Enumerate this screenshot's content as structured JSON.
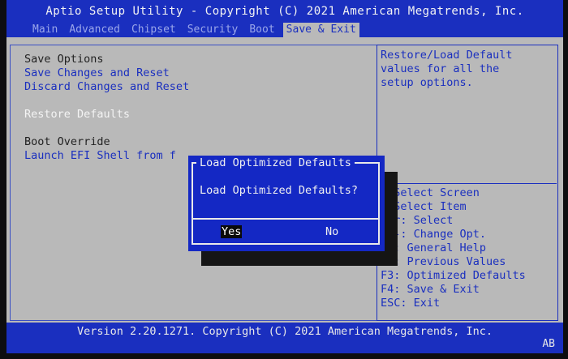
{
  "header": {
    "title": "Aptio Setup Utility - Copyright (C) 2021 American Megatrends, Inc.",
    "tabs": [
      {
        "label": "Main"
      },
      {
        "label": "Advanced"
      },
      {
        "label": "Chipset"
      },
      {
        "label": "Security"
      },
      {
        "label": "Boot"
      },
      {
        "label": "Save & Exit",
        "active": true
      }
    ]
  },
  "menu": {
    "save_options": "Save Options",
    "save_changes_reset": "Save Changes and Reset",
    "discard_changes_reset": "Discard Changes and Reset",
    "restore_defaults": "Restore Defaults",
    "boot_override": "Boot Override",
    "launch_efi_shell": "Launch EFI Shell from f"
  },
  "help": {
    "description": "Restore/Load Default\nvalues for all the\nsetup options.",
    "keys": [
      ": Select Screen",
      ": Select Item",
      "ter: Select",
      "+/-: Change Opt.",
      "F1: General Help",
      "F2: Previous Values",
      "F3: Optimized Defaults",
      "F4: Save & Exit",
      "ESC: Exit"
    ]
  },
  "dialog": {
    "title": "Load Optimized Defaults",
    "message": "Load Optimized Defaults?",
    "yes_label": "Yes",
    "no_label": "No"
  },
  "footer": {
    "version": "Version 2.20.1271. Copyright (C) 2021 American Megatrends, Inc.",
    "indicator": "AB"
  },
  "colors": {
    "bios_blue": "#1a2fbf",
    "dialog_blue": "#1428c4",
    "panel_gray": "#b9b9b9"
  }
}
